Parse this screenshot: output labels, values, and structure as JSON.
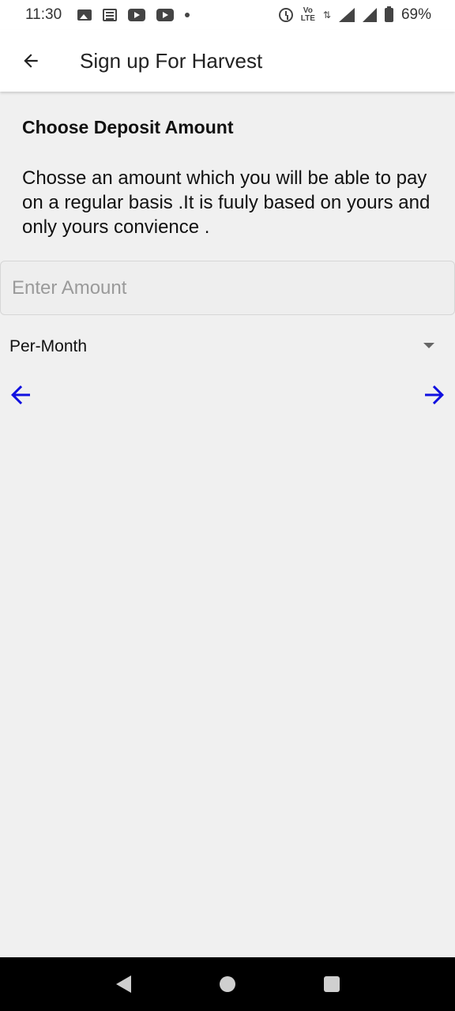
{
  "status_bar": {
    "time": "11:30",
    "volte_top": "Vo",
    "volte_bottom": "LTE",
    "battery_percent": "69%",
    "icons": [
      "image-icon",
      "news-icon",
      "youtube-icon",
      "youtube-icon",
      "dot-icon",
      "alarm-icon",
      "volte-icon",
      "data-arrows-icon",
      "wifi-signal-icon",
      "cell-signal-icon",
      "battery-icon"
    ]
  },
  "app_bar": {
    "back_icon": "arrow-back-icon",
    "title": "Sign up For Harvest"
  },
  "main": {
    "heading": "Choose Deposit Amount",
    "description": "Chosse an amount which you will be able to pay on a regular basis .It is fuuly based on yours and only yours convience .",
    "amount_input": {
      "value": "",
      "placeholder": "Enter Amount"
    },
    "period_select": {
      "selected": "Per-Month"
    },
    "prev_icon": "arrow-left-icon",
    "next_icon": "arrow-right-icon",
    "accent_color": "#1010e0"
  },
  "system_nav": {
    "back": "back-triangle-icon",
    "home": "home-circle-icon",
    "recents": "recents-square-icon"
  }
}
